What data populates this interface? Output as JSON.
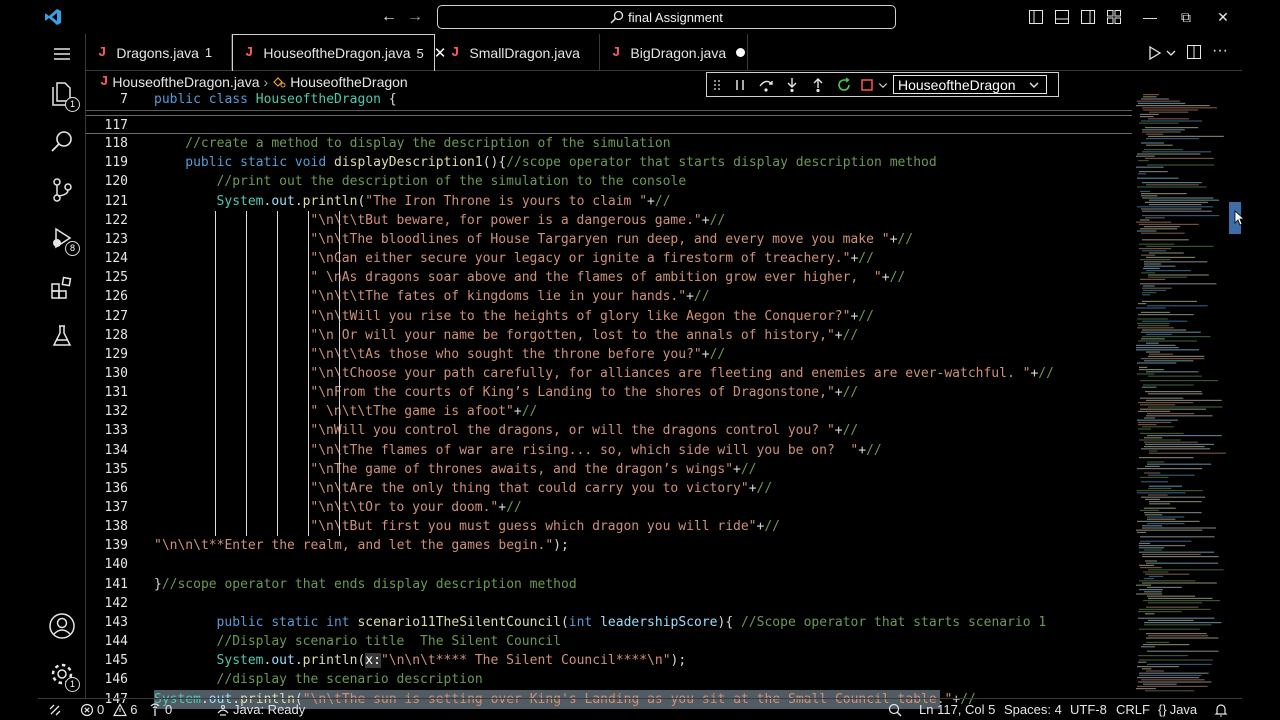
{
  "window": {
    "command_center": "final Assignment"
  },
  "tabs": [
    {
      "label": "Dragons.java",
      "badge": "1"
    },
    {
      "label": "HouseoftheDragon.java",
      "badge": "5"
    },
    {
      "label": "SmallDragon.java"
    },
    {
      "label": "BigDragon.java"
    }
  ],
  "breadcrumb": {
    "file": "HouseoftheDragon.java",
    "symbol": "HouseoftheDragon"
  },
  "debug": {
    "target": "HouseoftheDragon"
  },
  "activity": {
    "explorer_badge": "1",
    "debug_badge": "8",
    "settings_badge": "1"
  },
  "editor": {
    "sticky_line": {
      "num": "7",
      "text": "public class HouseoftheDragon {"
    },
    "lines": [
      {
        "num": "117",
        "text": ""
      },
      {
        "num": "118",
        "text": "//create a method to display the description of the simulation"
      },
      {
        "num": "119",
        "text": "public static void displayDescription1(){//scope operator that starts display description method"
      },
      {
        "num": "120",
        "text": "//print out the description of the simulation to the console"
      },
      {
        "num": "121",
        "text": "System.out.println(\"The Iron Throne is yours to claim \"+//"
      },
      {
        "num": "122",
        "text": "\"\\n\\t\\tBut beware, for power is a dangerous game.\"+//"
      },
      {
        "num": "123",
        "text": "\"\\n\\tThe bloodlines of House Targaryen run deep, and every move you make \"+//"
      },
      {
        "num": "124",
        "text": "\"\\nCan either secure your legacy or ignite a firestorm of treachery.\"+//"
      },
      {
        "num": "125",
        "text": "\" \\nAs dragons soar above and the flames of ambition grow ever higher,  \"+//"
      },
      {
        "num": "126",
        "text": "\"\\n\\t\\tThe fates of kingdoms lie in your hands.\"+//"
      },
      {
        "num": "127",
        "text": "\"\\n\\tWill you rise to the heights of glory like Aegon the Conqueror?\"+//"
      },
      {
        "num": "128",
        "text": "\"\\n Or will your name be forgotten, lost to the annals of history,\"+//"
      },
      {
        "num": "129",
        "text": "\"\\n\\t\\tAs those who sought the throne before you?\"+//"
      },
      {
        "num": "130",
        "text": "\"\\n\\tChoose your path carefully, for alliances are fleeting and enemies are ever-watchful. \"+//"
      },
      {
        "num": "131",
        "text": "\"\\nFrom the courts of King’s Landing to the shores of Dragonstone,\"+//"
      },
      {
        "num": "132",
        "text": "\" \\n\\t\\tThe game is afoot\"+//"
      },
      {
        "num": "133",
        "text": "\"\\nWill you control the dragons, or will the dragons control you? \"+//"
      },
      {
        "num": "134",
        "text": "\"\\n\\tThe flames of war are rising... so, which side will you be on?  \"+//"
      },
      {
        "num": "135",
        "text": "\"\\nThe game of thrones awaits, and the dragon’s wings\"+//"
      },
      {
        "num": "136",
        "text": "\"\\n\\tAre the only thing that could carry you to victory\"+//"
      },
      {
        "num": "137",
        "text": "\"\\n\\t\\tOr to your doom.\"+//"
      },
      {
        "num": "138",
        "text": "\"\\n\\tBut first you must guess which dragon you will ride\"+//"
      },
      {
        "num": "139",
        "text": "\"\\n\\n\\t**Enter the realm, and let the games begin.\");"
      },
      {
        "num": "140",
        "text": ""
      },
      {
        "num": "141",
        "text": "}//scope operator that ends display description method"
      },
      {
        "num": "142",
        "text": ""
      },
      {
        "num": "143",
        "text": "public static int scenario11TheSilentCouncil(int leadershipScore){ //Scope operator that starts scenario 1"
      },
      {
        "num": "144",
        "text": "//Display scenario title  The Silent Council"
      },
      {
        "num": "145",
        "text": "System.out.println(x:\"\\n\\n\\t**** The Silent Council****\\n\");"
      },
      {
        "num": "146",
        "text": "//display the scenario description"
      },
      {
        "num": "147",
        "text": "System.out.println(\"\\n\\tThe sun is setting over King's Landing as you sit at the Small Council table.\"+//"
      }
    ]
  },
  "status": {
    "errors": "0",
    "warnings": "6",
    "ports": "0",
    "java_status": "Java: Ready",
    "cursor": "Ln 117, Col 5",
    "spaces": "Spaces: 4",
    "encoding": "UTF-8",
    "eol": "CRLF",
    "language": "Java"
  }
}
